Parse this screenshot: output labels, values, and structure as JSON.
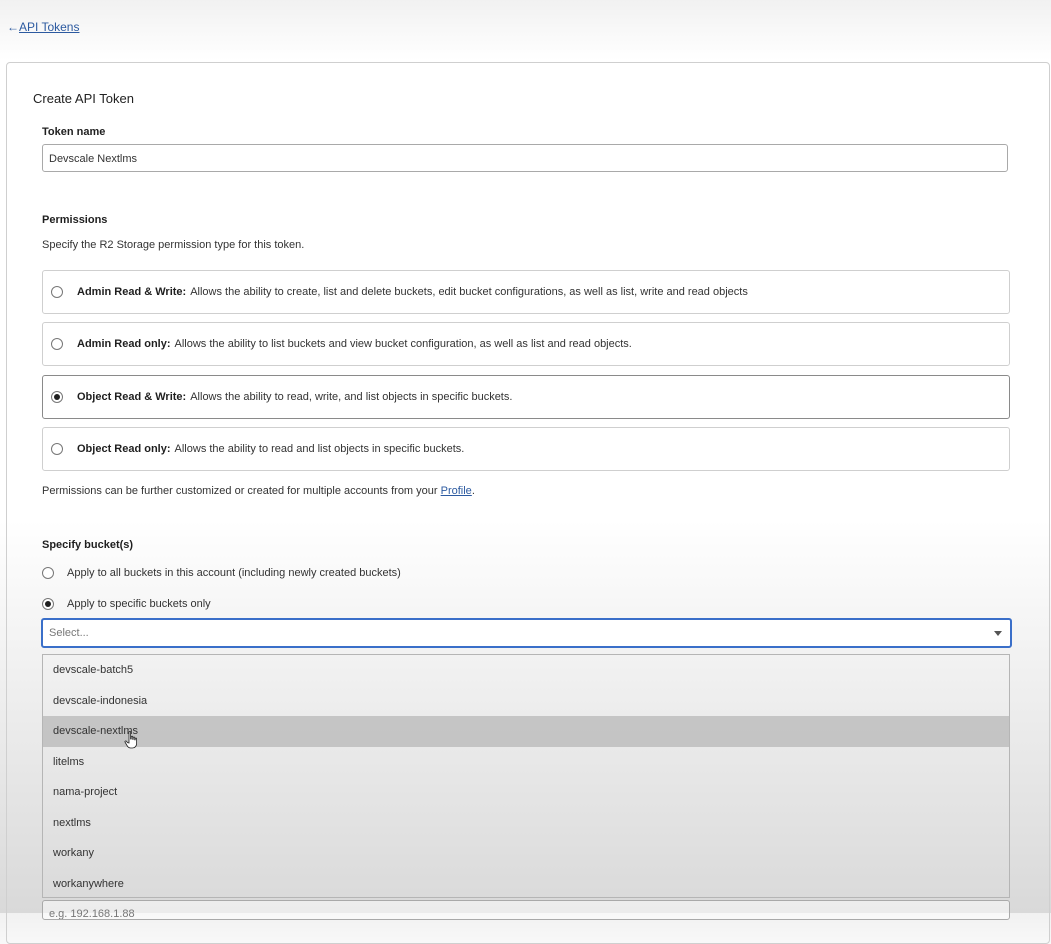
{
  "nav": {
    "back_arrow": "←",
    "back_label": "API Tokens"
  },
  "form": {
    "title": "Create API Token",
    "token_name": {
      "label": "Token name",
      "value": "Devscale Nextlms"
    },
    "permissions": {
      "label": "Permissions",
      "description": "Specify the R2 Storage permission type for this token.",
      "options": [
        {
          "name": "Admin Read & Write:",
          "desc": "Allows the ability to create, list and delete buckets, edit bucket configurations, as well as list, write and read objects",
          "selected": false
        },
        {
          "name": "Admin Read only:",
          "desc": "Allows the ability to list buckets and view bucket configuration, as well as list and read objects.",
          "selected": false
        },
        {
          "name": "Object Read & Write:",
          "desc": "Allows the ability to read, write, and list objects in specific buckets.",
          "selected": true
        },
        {
          "name": "Object Read only:",
          "desc": "Allows the ability to read and list objects in specific buckets.",
          "selected": false
        }
      ],
      "note_prefix": "Permissions can be further customized or created for multiple accounts from your ",
      "note_link": "Profile",
      "note_suffix": "."
    },
    "buckets": {
      "label": "Specify bucket(s)",
      "options": [
        {
          "label": "Apply to all buckets in this account (including newly created buckets)",
          "selected": false
        },
        {
          "label": "Apply to specific buckets only",
          "selected": true
        }
      ],
      "select_placeholder": "Select...",
      "dropdown_items": [
        "devscale-batch5",
        "devscale-indonesia",
        "devscale-nextlms",
        "litelms",
        "nama-project",
        "nextlms",
        "workany",
        "workanywhere"
      ],
      "hovered_item": "devscale-nextlms"
    },
    "ip_field_placeholder": "e.g. 192.168.1.88"
  }
}
